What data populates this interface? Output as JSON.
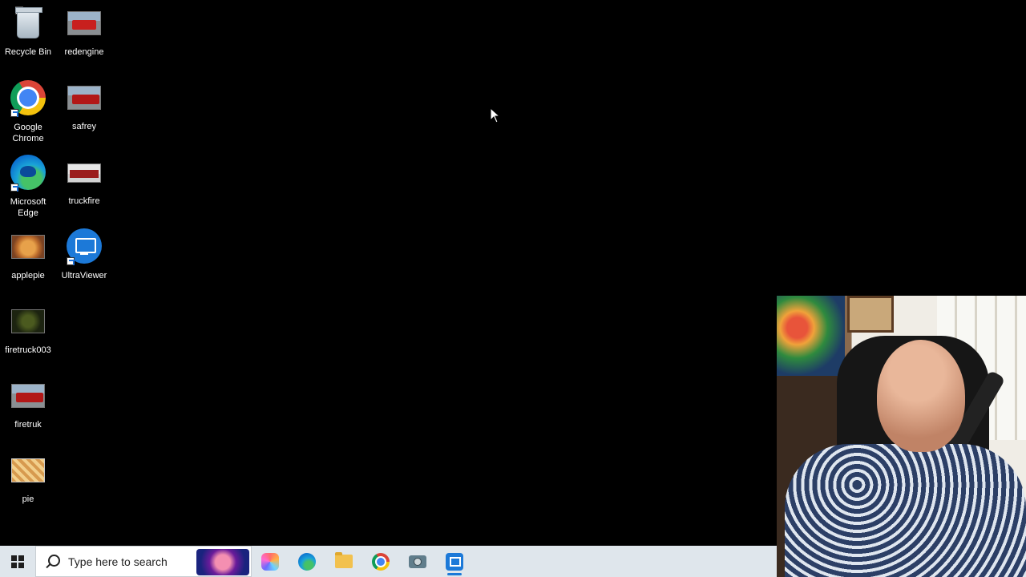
{
  "desktop": {
    "icons": [
      {
        "label": "Recycle Bin",
        "icon": "recycle-bin-icon"
      },
      {
        "label": "redengine",
        "icon": "image-thumbnail-icon"
      },
      {
        "label": "Google Chrome",
        "icon": "chrome-icon"
      },
      {
        "label": "safrey",
        "icon": "image-thumbnail-icon"
      },
      {
        "label": "Microsoft Edge",
        "icon": "edge-icon"
      },
      {
        "label": "truckfire",
        "icon": "image-thumbnail-icon"
      },
      {
        "label": "applepie",
        "icon": "image-thumbnail-icon"
      },
      {
        "label": "UltraViewer",
        "icon": "ultraviewer-icon"
      },
      {
        "label": "firetruck003",
        "icon": "image-thumbnail-icon"
      },
      {
        "label": "firetruk",
        "icon": "image-thumbnail-icon"
      },
      {
        "label": "pie",
        "icon": "image-thumbnail-icon"
      }
    ]
  },
  "taskbar": {
    "search_placeholder": "Type here to search",
    "apps": [
      "copilot-icon",
      "edge-icon",
      "file-explorer-icon",
      "chrome-icon",
      "camera-icon",
      "ultraviewer-icon"
    ],
    "active_app": "ultraviewer-icon",
    "accent": "#1c79d8",
    "background": "#dfe6ec"
  },
  "webcam": {
    "description_icon": "webcam-overlay"
  }
}
